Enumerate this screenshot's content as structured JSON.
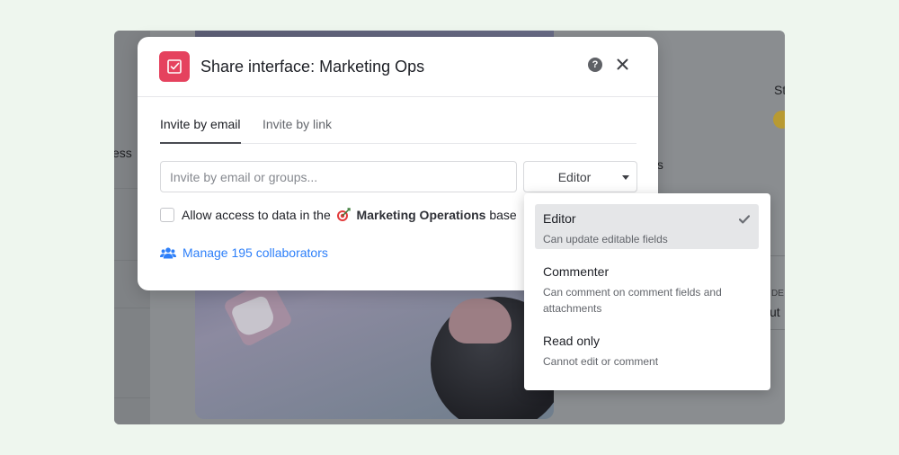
{
  "background": {
    "left_text": "ess",
    "right_text_top": "St",
    "right_text_mid": "ts",
    "right_text_label": "DE",
    "right_text_bottom": "ut"
  },
  "modal": {
    "title": "Share interface: Marketing Ops",
    "help_symbol": "?",
    "tabs": [
      {
        "label": "Invite by email",
        "active": true
      },
      {
        "label": "Invite by link",
        "active": false
      }
    ],
    "email_input": {
      "value": "",
      "placeholder": "Invite by email or groups..."
    },
    "role_select": {
      "value": "Editor"
    },
    "checkbox": {
      "checked": false,
      "label_prefix": "Allow access to data in the",
      "base_name": "Marketing Operations",
      "label_suffix": "base"
    },
    "manage_link": "Manage 195 collaborators"
  },
  "dropdown": {
    "options": [
      {
        "title": "Editor",
        "description": "Can update editable fields",
        "selected": true
      },
      {
        "title": "Commenter",
        "description": "Can comment on comment fields and attachments",
        "selected": false
      },
      {
        "title": "Read only",
        "description": "Cannot edit or comment",
        "selected": false
      }
    ]
  },
  "colors": {
    "page_background": "#eef6ee",
    "brand_icon": "#e5425e",
    "link": "#2d7ff9",
    "selected_option": "#e5e6e8"
  },
  "icons": {
    "brand": "checkbox-icon",
    "help": "question-circle-icon",
    "close": "close-icon",
    "base": "dart-target-icon",
    "collaborators": "people-icon",
    "selected": "check-icon",
    "select_caret": "caret-down-icon"
  }
}
